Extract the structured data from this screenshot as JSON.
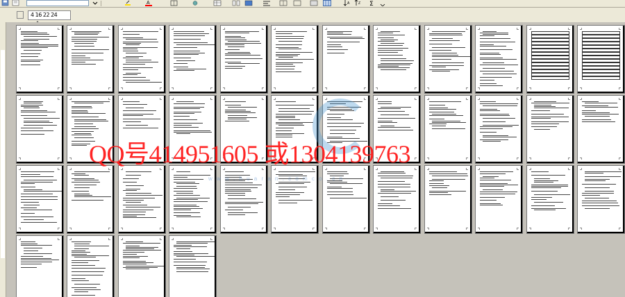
{
  "toolbar": {
    "icons": [
      "save-icon",
      "font-color-icon",
      "border-icon",
      "table-icon",
      "columns-icon",
      "align-icon",
      "sort-ascending-icon",
      "sort-descending-icon",
      "autosum-icon"
    ]
  },
  "ruler": {
    "text": "4  16 22  24"
  },
  "page_grid": {
    "rows": 4,
    "pages_per_row": [
      12,
      12,
      12,
      4
    ]
  },
  "watermark": {
    "text": "QQ号414951605 或1304139763",
    "color": "#ff1a1a"
  },
  "logo": {
    "url_text": "w w w . h u a r a n . c o m  c o . c n"
  }
}
